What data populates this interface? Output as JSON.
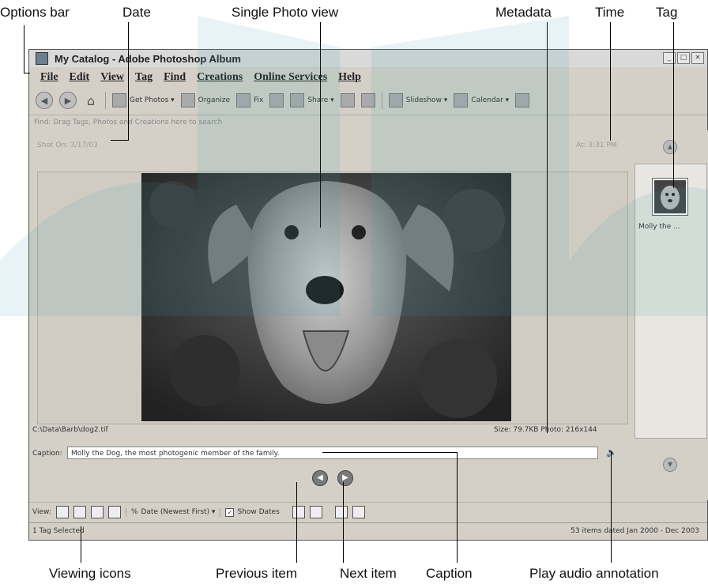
{
  "callouts": {
    "options_bar": "Options bar",
    "date": "Date",
    "single_photo_view": "Single Photo view",
    "metadata": "Metadata",
    "time": "Time",
    "tag": "Tag",
    "viewing_icons": "Viewing icons",
    "previous_item": "Previous item",
    "next_item": "Next item",
    "caption": "Caption",
    "play_audio": "Play audio annotation"
  },
  "window": {
    "title": "My Catalog - Adobe Photoshop Album"
  },
  "menu": [
    "File",
    "Edit",
    "View",
    "Tag",
    "Find",
    "Creations",
    "Online Services",
    "Help"
  ],
  "toolbar": {
    "get_photos": "Get Photos ▾",
    "organize": "Organize",
    "fix": "Fix",
    "share": "Share ▾",
    "slideshow": "Slideshow ▾",
    "calendar": "Calendar ▾"
  },
  "find_bar": "Find: Drag Tags, Photos and Creations here to search",
  "photo": {
    "shot_on": "Shot On: 3/17/03",
    "at": "At: 3:31 PM",
    "path": "C:\\Data\\Barb\\dog2.tif",
    "size": "Size: 79.7KB  Photo: 216x144",
    "caption_label": "Caption:",
    "caption_value": "Molly the Dog, the most photogenic member of the family."
  },
  "tag": {
    "label": "Molly the ..."
  },
  "view_bar": {
    "view_label": "View:",
    "sort": "Date (Newest First) ▾",
    "show_dates": "Show Dates"
  },
  "status": {
    "left": "1 Tag Selected",
    "right": "53 items dated Jan 2000 - Dec 2003"
  },
  "icons": {
    "back": "back-arrow-icon",
    "forward": "forward-arrow-icon",
    "home": "home-icon",
    "speaker": "speaker-icon"
  }
}
